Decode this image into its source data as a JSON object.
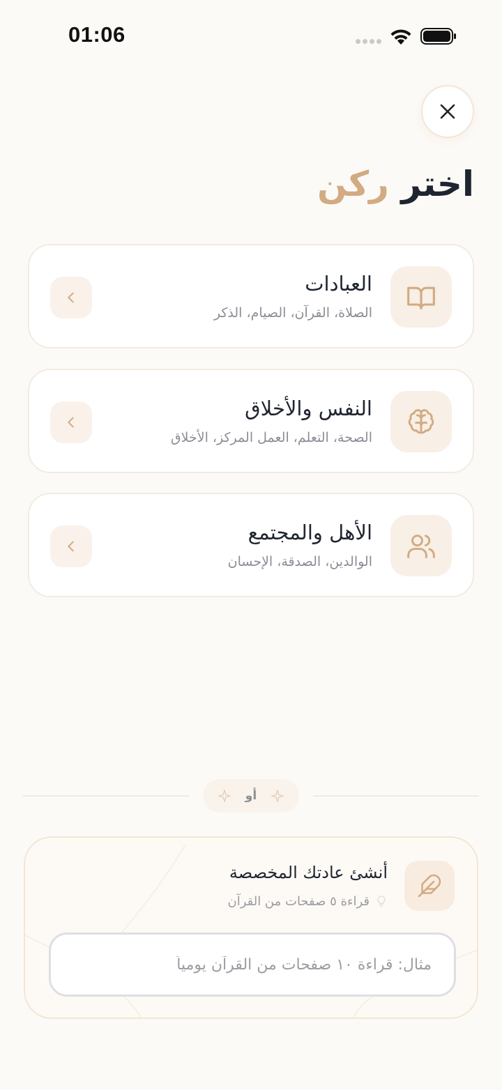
{
  "status_bar": {
    "time": "01:06",
    "icons": [
      "cellular-signal-icon",
      "wifi-icon",
      "battery-icon"
    ]
  },
  "header": {
    "close_icon": "close-icon",
    "title_part1": "اختر",
    "title_part2": "ركن"
  },
  "categories": [
    {
      "title": "العبادات",
      "subtitle": "الصلاة، القرآن، الصيام، الذكر",
      "icon": "open-book-icon"
    },
    {
      "title": "النفس والأخلاق",
      "subtitle": "الصحة، التعلم، العمل المركز، الأخلاق",
      "icon": "brain-icon"
    },
    {
      "title": "الأهل والمجتمع",
      "subtitle": "الوالدين، الصدقة، الإحسان",
      "icon": "users-icon"
    }
  ],
  "divider": {
    "label": "أو",
    "icon": "sparkles-icon"
  },
  "custom_habit": {
    "title": "أنشئ عادتك المخصصة",
    "hint": "قراءة ٥ صفحات من القرآن",
    "hint_icon": "lightbulb-icon",
    "icon": "feather-icon",
    "input_placeholder": "مثال: قراءة ١٠ صفحات من القرآن يومياً",
    "input_value": ""
  },
  "colors": {
    "background": "#fcfaf7",
    "accent": "#d2ab82",
    "text_primary": "#1f2530",
    "text_secondary": "#8a8d94",
    "icon_box": "#f8efe6"
  }
}
